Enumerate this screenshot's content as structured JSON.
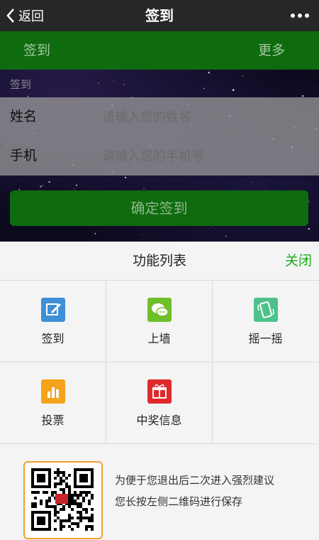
{
  "navbar": {
    "back_label": "返回",
    "title": "签到"
  },
  "tabbar": {
    "left": "签到",
    "right": "更多"
  },
  "form": {
    "section_label": "签到",
    "name_label": "姓名",
    "name_placeholder": "请输入您的姓名",
    "phone_label": "手机",
    "phone_placeholder": "请输入您的手机号",
    "submit_label": "确定签到"
  },
  "sheet": {
    "title": "功能列表",
    "close_label": "关闭",
    "items": [
      {
        "label": "签到",
        "icon": "sign-in-icon",
        "color": "#3d8fd6"
      },
      {
        "label": "上墙",
        "icon": "chat-wall-icon",
        "color": "#6fbf2a"
      },
      {
        "label": "摇一摇",
        "icon": "shake-phone-icon",
        "color": "#4cc28a"
      },
      {
        "label": "投票",
        "icon": "vote-chart-icon",
        "color": "#f5a31a"
      },
      {
        "label": "中奖信息",
        "icon": "gift-icon",
        "color": "#e0292b"
      }
    ],
    "qr_hint_line1": "为便于您退出后二次进入强烈建议",
    "qr_hint_line2": "您长按左侧二维码进行保存"
  },
  "colors": {
    "brand_green": "#0e6b0e",
    "close_green": "#1aac19",
    "qr_border": "#f0a030"
  }
}
